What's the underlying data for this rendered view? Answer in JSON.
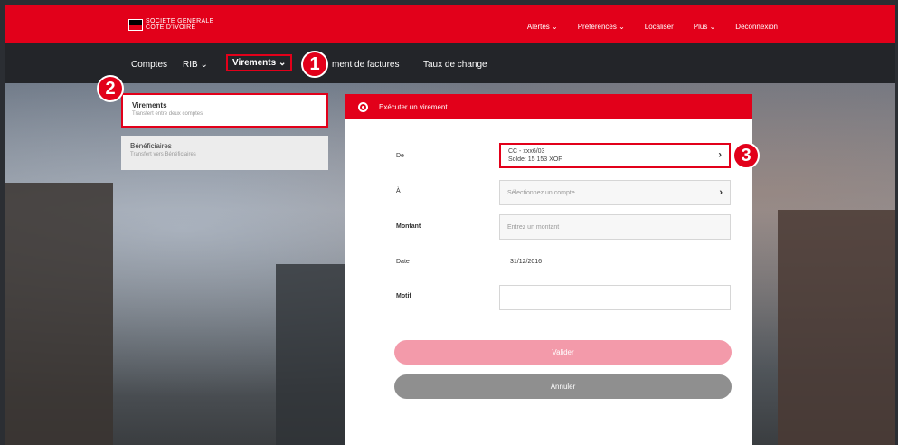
{
  "brand": {
    "line1": "SOCIETE GENERALE",
    "line2": "COTE D'IVOIRE"
  },
  "topnav": [
    "Alertes ⌄",
    "Préférences ⌄",
    "Localiser",
    "Plus ⌄",
    "Déconnexion"
  ],
  "subnav": {
    "comptes": "Comptes",
    "rib": "RIB ⌄",
    "virements": "Virements ⌄",
    "factures": "ment de factures",
    "change": "Taux de change"
  },
  "sidebar": [
    {
      "title": "Virements",
      "subtitle": "Transfert entre deux comptes"
    },
    {
      "title": "Bénéficiaires",
      "subtitle": "Transfert vers Bénéficiaires"
    }
  ],
  "panel": {
    "title": "Exécuter un virement",
    "de_label": "De",
    "de_value_line1": "CC - xxx6/03",
    "de_value_line2": "Solde: 15 153 XOF",
    "a_label": "À",
    "a_placeholder": "Sélectionnez un compte",
    "montant_label": "Montant",
    "montant_placeholder": "Entrez un montant",
    "date_label": "Date",
    "date_value": "31/12/2016",
    "motif_label": "Motif",
    "valider": "Valider",
    "annuler": "Annuler"
  },
  "markers": [
    "1",
    "2",
    "3"
  ],
  "colors": {
    "accent": "#e2001a",
    "nav_dark": "#232529"
  }
}
